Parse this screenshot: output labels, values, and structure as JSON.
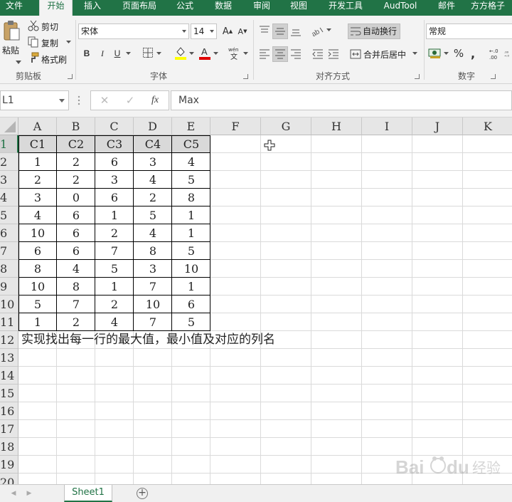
{
  "ribbon_tabs": [
    "文件",
    "开始",
    "插入",
    "页面布局",
    "公式",
    "数据",
    "审阅",
    "视图",
    "开发工具",
    "AudTool",
    "邮件",
    "方方格子"
  ],
  "active_tab": "开始",
  "clipboard": {
    "paste": "粘贴",
    "cut": "剪切",
    "copy": "复制",
    "format_painter": "格式刷",
    "group_label": "剪贴板"
  },
  "font": {
    "name": "宋体",
    "size": "14",
    "bold": "B",
    "italic": "I",
    "underline": "U",
    "group_label": "字体"
  },
  "alignment": {
    "wrap_text": "自动换行",
    "merge_center": "合并后居中",
    "group_label": "对齐方式"
  },
  "number": {
    "format": "常规",
    "percent": "%",
    "comma": ",",
    "group_label": "数字"
  },
  "formula_bar": {
    "name_box": "L1",
    "cancel": "✕",
    "enter": "✓",
    "fx": "fx",
    "content": "Max"
  },
  "columns": [
    "A",
    "B",
    "C",
    "D",
    "E",
    "F",
    "G",
    "H",
    "I",
    "J",
    "K"
  ],
  "rows": [
    "1",
    "2",
    "3",
    "4",
    "5",
    "6",
    "7",
    "8",
    "9",
    "10",
    "11",
    "12",
    "13",
    "14",
    "15",
    "16",
    "17",
    "18",
    "19",
    "20"
  ],
  "table": {
    "headers": [
      "C1",
      "C2",
      "C3",
      "C4",
      "C5"
    ],
    "rows": [
      [
        "1",
        "2",
        "6",
        "3",
        "4"
      ],
      [
        "2",
        "2",
        "3",
        "4",
        "5"
      ],
      [
        "3",
        "0",
        "6",
        "2",
        "8"
      ],
      [
        "4",
        "6",
        "1",
        "5",
        "1"
      ],
      [
        "10",
        "6",
        "2",
        "4",
        "1"
      ],
      [
        "6",
        "6",
        "7",
        "8",
        "5"
      ],
      [
        "8",
        "4",
        "5",
        "3",
        "10"
      ],
      [
        "10",
        "8",
        "1",
        "7",
        "1"
      ],
      [
        "5",
        "7",
        "2",
        "10",
        "6"
      ],
      [
        "1",
        "2",
        "4",
        "7",
        "5"
      ]
    ]
  },
  "note": "实现找出每一行的最大值，最小值及对应的列名",
  "sheet_tabs": [
    "Sheet1"
  ],
  "watermark": "Baidu经验",
  "colors": {
    "accent": "#217346"
  }
}
